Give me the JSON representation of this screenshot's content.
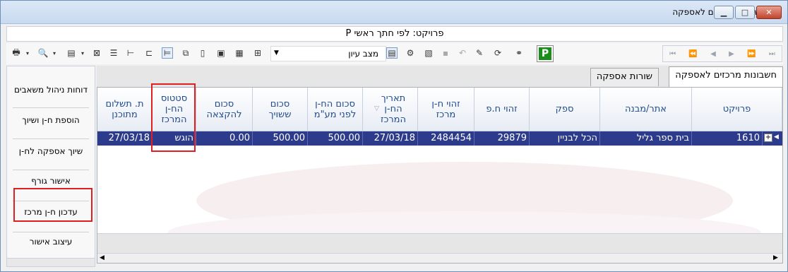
{
  "window": {
    "title": "חשבונות מרכזים לאספקה",
    "subtitle": "פרויקט: לפי חתך ראשי P",
    "controls": [
      "minimize",
      "maximize",
      "close"
    ]
  },
  "toolbar": {
    "view_mode_value": "מצב עיון",
    "p_label": "P",
    "icons": [
      "print-icon",
      "preview-icon",
      "export-icon",
      "excel-icon",
      "columns-icon",
      "tree-icon",
      "group-icon",
      "filter-icon",
      "copy-icon",
      "page-icon",
      "document-icon",
      "save-icon",
      "undo-icon",
      "tools-icon",
      "refresh-icon",
      "binoculars-icon"
    ],
    "nav": [
      "first",
      "prev-page",
      "prev",
      "next",
      "next-page",
      "last"
    ]
  },
  "sidebar": {
    "items": [
      {
        "label": "דוחות ניהול משאבים"
      },
      {
        "label": "הוספת ח-ן ושיוך"
      },
      {
        "label": "שיוך אספקה לח-ן"
      },
      {
        "label": "אישור גורף"
      },
      {
        "label": "עדכון ח-ן מרכז"
      },
      {
        "label": "עיצוב אישור"
      }
    ]
  },
  "tabs": [
    {
      "label": "חשבונות מרכזים לאספקה",
      "active": true
    },
    {
      "label": "שורות אספקה",
      "active": false
    }
  ],
  "grid": {
    "columns": [
      {
        "key": "project",
        "label": "פרויקט"
      },
      {
        "key": "site",
        "label": "אתר/מבנה"
      },
      {
        "key": "supplier",
        "label": "ספק"
      },
      {
        "key": "supplier_id",
        "label": "זהוי ח.פ"
      },
      {
        "key": "invoice_id",
        "label": "זהוי ח-ן מרכז"
      },
      {
        "key": "invoice_date",
        "label": "תאריך החשבון המרכז"
      },
      {
        "key": "amount_before_vat",
        "label": "סכום החשבון לפני מע\"מ"
      },
      {
        "key": "amount_linked",
        "label": "סכום ששויך"
      },
      {
        "key": "amount_to_allocate",
        "label": "סכום להקצאה"
      },
      {
        "key": "status",
        "label": "סטטוס החשבון המרכז"
      },
      {
        "key": "payment_date",
        "label": "ת. תשלום מתוכנן"
      }
    ],
    "column_display": {
      "invoice_id": [
        "זהוי ח-ן",
        "מרכז"
      ],
      "invoice_date": [
        "תאריך",
        "הח-ן",
        "המרכז"
      ],
      "amount_before_vat": [
        "סכום הח-ן",
        "לפני מע\"מ"
      ],
      "amount_linked": [
        "סכום",
        "ששויך"
      ],
      "amount_to_allocate": [
        "סכום",
        "להקצאה"
      ],
      "status": [
        "סטטוס",
        "הח-ן",
        "המרכז"
      ],
      "payment_date": [
        "ת. תשלום",
        "מתוכנן"
      ]
    },
    "rows": [
      {
        "project": "1610",
        "site": "בית ספר גליל",
        "supplier": "הכל לבניין",
        "supplier_id": "29879",
        "invoice_id": "2484454",
        "invoice_date": "27/03/18",
        "amount_before_vat": "500.00",
        "amount_linked": "500.00",
        "amount_to_allocate": "0.00",
        "status": "הוגש",
        "payment_date": "27/03/18"
      }
    ]
  },
  "colors": {
    "selected_row": "#2d3b8c",
    "header_text": "#1f4b8e",
    "highlight": "#e02020",
    "p_button": "#1a8d1a"
  }
}
